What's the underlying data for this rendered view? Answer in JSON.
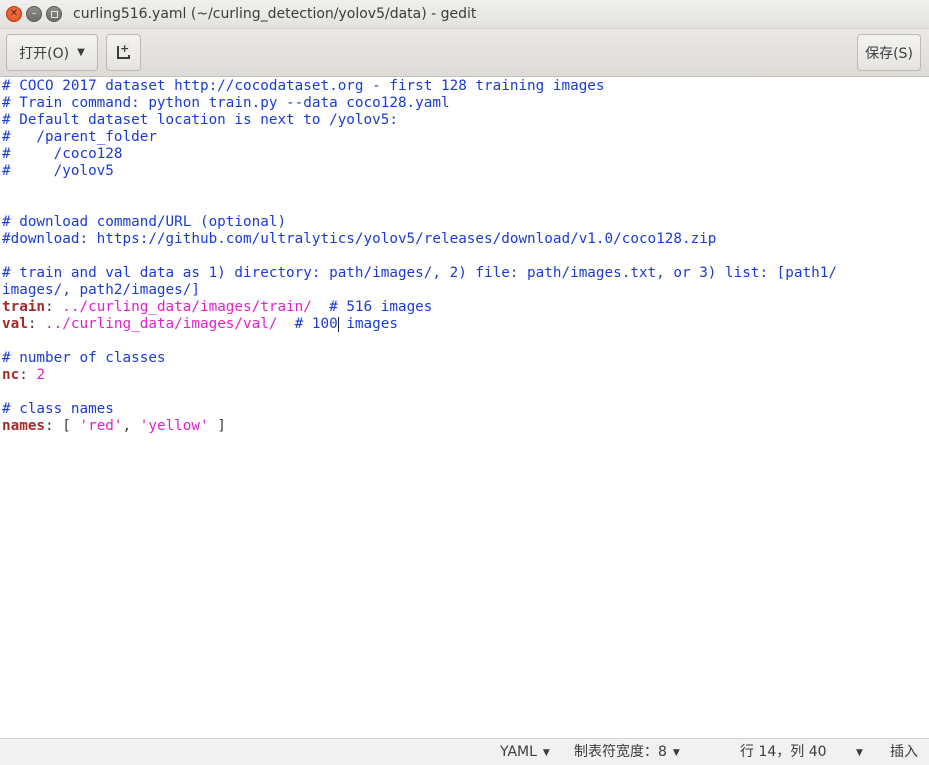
{
  "window": {
    "title": "curling516.yaml (~/curling_detection/yolov5/data) - gedit",
    "close_glyph": "✕",
    "min_glyph": "–"
  },
  "toolbar": {
    "open_label": "打开(O)",
    "open_arrow": "▼",
    "save_label": "保存(S)"
  },
  "editor": {
    "lines": [
      {
        "segments": [
          {
            "cls": "c-comment",
            "text": "# COCO 2017 dataset http://cocodataset.org - first 128 training images"
          }
        ]
      },
      {
        "segments": [
          {
            "cls": "c-comment",
            "text": "# Train command: python train.py --data coco128.yaml"
          }
        ]
      },
      {
        "segments": [
          {
            "cls": "c-comment",
            "text": "# Default dataset location is next to /yolov5:"
          }
        ]
      },
      {
        "segments": [
          {
            "cls": "c-comment",
            "text": "#   /parent_folder"
          }
        ]
      },
      {
        "segments": [
          {
            "cls": "c-comment",
            "text": "#     /coco128"
          }
        ]
      },
      {
        "segments": [
          {
            "cls": "c-comment",
            "text": "#     /yolov5"
          }
        ]
      },
      {
        "segments": []
      },
      {
        "segments": []
      },
      {
        "segments": [
          {
            "cls": "c-comment",
            "text": "# download command/URL (optional)"
          }
        ]
      },
      {
        "segments": [
          {
            "cls": "c-comment",
            "text": "#download: https://github.com/ultralytics/yolov5/releases/download/v1.0/coco128.zip"
          }
        ]
      },
      {
        "segments": []
      },
      {
        "segments": [
          {
            "cls": "c-comment",
            "text": "# train and val data as 1) directory: path/images/, 2) file: path/images.txt, or 3) list: [path1/"
          }
        ]
      },
      {
        "segments": [
          {
            "cls": "c-comment",
            "text": "images/, path2/images/]"
          }
        ]
      },
      {
        "segments": [
          {
            "cls": "c-key",
            "text": "train"
          },
          {
            "cls": "c-plain",
            "text": ": "
          },
          {
            "cls": "c-str",
            "text": "../curling_data/images/train/"
          },
          {
            "cls": "c-plain",
            "text": "  "
          },
          {
            "cls": "c-comment",
            "text": "# 516 images"
          }
        ]
      },
      {
        "segments": [
          {
            "cls": "c-key",
            "text": "val"
          },
          {
            "cls": "c-plain",
            "text": ": "
          },
          {
            "cls": "c-str",
            "text": "../curling_data/images/val/"
          },
          {
            "cls": "c-plain",
            "text": "  "
          },
          {
            "cls": "c-comment",
            "text": "# 100"
          },
          {
            "cls": "cursor",
            "text": ""
          },
          {
            "cls": "c-comment",
            "text": " images"
          }
        ]
      },
      {
        "segments": []
      },
      {
        "segments": [
          {
            "cls": "c-comment",
            "text": "# number of classes"
          }
        ]
      },
      {
        "segments": [
          {
            "cls": "c-key",
            "text": "nc"
          },
          {
            "cls": "c-plain",
            "text": ": "
          },
          {
            "cls": "c-num",
            "text": "2"
          }
        ]
      },
      {
        "segments": []
      },
      {
        "segments": [
          {
            "cls": "c-comment",
            "text": "# class names"
          }
        ]
      },
      {
        "segments": [
          {
            "cls": "c-key",
            "text": "names"
          },
          {
            "cls": "c-plain",
            "text": ": [ "
          },
          {
            "cls": "c-str",
            "text": "'red'"
          },
          {
            "cls": "c-plain",
            "text": ", "
          },
          {
            "cls": "c-str",
            "text": "'yellow'"
          },
          {
            "cls": "c-plain",
            "text": " ]"
          }
        ]
      }
    ]
  },
  "statusbar": {
    "language": "YAML",
    "tab_width": "制表符宽度：8",
    "position": "行 14，列 40",
    "mode": "插入",
    "dropdown_arrow": "▼"
  }
}
